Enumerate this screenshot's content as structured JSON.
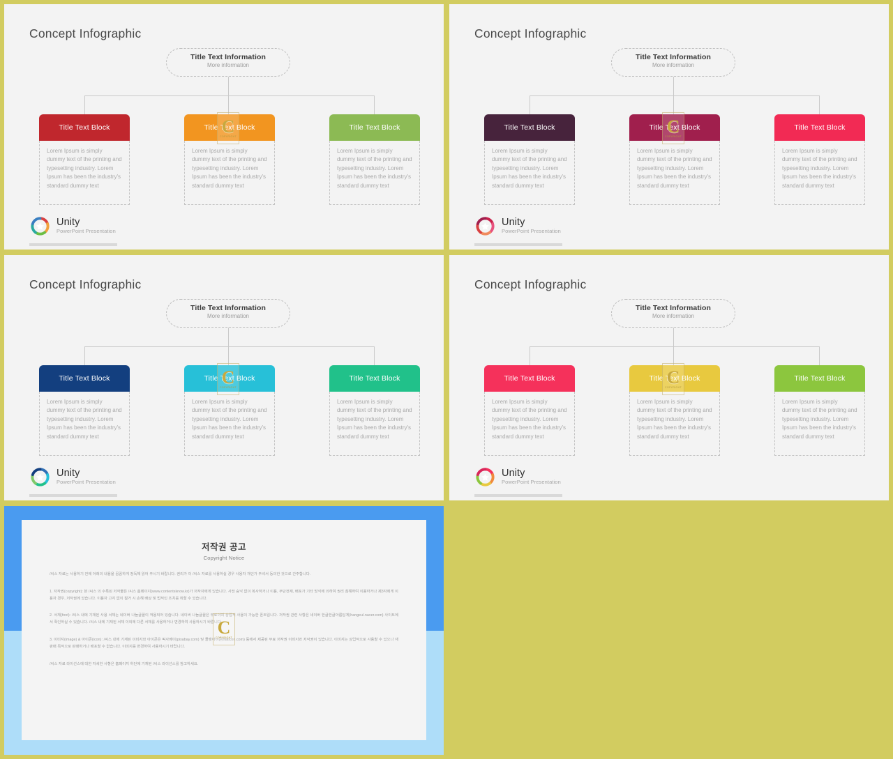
{
  "page": {
    "background_color": "#d2cc60",
    "divider_color": "#d2cc60"
  },
  "watermark": {
    "letter": "C",
    "caption": "COPYRIGHT"
  },
  "brand": {
    "name": "Unity",
    "tagline": "PowerPoint Presentation"
  },
  "slides": [
    {
      "id": "slide-1",
      "title": "Concept Infographic",
      "root": {
        "title": "Title  Text Information",
        "subtitle": "More information"
      },
      "cards": [
        {
          "title": "Title  Text Block",
          "color": "#c0272d",
          "body": "Lorem Ipsum is simply dummy text of the printing and typesetting industry. Lorem Ipsum has been the industry's standard dummy text"
        },
        {
          "title": "Title  Text Block",
          "color": "#f29520",
          "body": "Lorem Ipsum is simply dummy text of the printing and typesetting industry. Lorem Ipsum has been the industry's standard dummy text"
        },
        {
          "title": "Title  Text Block",
          "color": "#8cba54",
          "body": "Lorem Ipsum is simply dummy text of the printing and typesetting industry. Lorem Ipsum has been the industry's standard dummy text"
        }
      ]
    },
    {
      "id": "slide-2",
      "title": "Concept Infographic",
      "root": {
        "title": "Title  Text Information",
        "subtitle": "More information"
      },
      "cards": [
        {
          "title": "Title  Text Block",
          "color": "#47233c",
          "body": "Lorem Ipsum is simply dummy text of the printing and typesetting industry. Lorem Ipsum has been the industry's standard dummy text"
        },
        {
          "title": "Title  Text Block",
          "color": "#a01f4d",
          "body": "Lorem Ipsum is simply dummy text of the printing and typesetting industry. Lorem Ipsum has been the industry's standard dummy text"
        },
        {
          "title": "Title  Text Block",
          "color": "#f22a54",
          "body": "Lorem Ipsum is simply dummy text of the printing and typesetting industry. Lorem Ipsum has been the industry's standard dummy text"
        }
      ]
    },
    {
      "id": "slide-3",
      "title": "Concept Infographic",
      "root": {
        "title": "Title  Text Information",
        "subtitle": "More information"
      },
      "cards": [
        {
          "title": "Title  Text Block",
          "color": "#133f7f",
          "body": "Lorem Ipsum is simply dummy text of the printing and typesetting industry. Lorem Ipsum has been the industry's standard dummy text"
        },
        {
          "title": "Title  Text Block",
          "color": "#27c0d8",
          "body": "Lorem Ipsum is simply dummy text of the printing and typesetting industry. Lorem Ipsum has been the industry's standard dummy text"
        },
        {
          "title": "Title  Text Block",
          "color": "#21c18a",
          "body": "Lorem Ipsum is simply dummy text of the printing and typesetting industry. Lorem Ipsum has been the industry's standard dummy text"
        }
      ]
    },
    {
      "id": "slide-4",
      "title": "Concept Infographic",
      "root": {
        "title": "Title  Text Information",
        "subtitle": "More information"
      },
      "cards": [
        {
          "title": "Title  Text Block",
          "color": "#f5315b",
          "body": "Lorem Ipsum is simply dummy text of the printing and typesetting industry. Lorem Ipsum has been the industry's standard dummy text"
        },
        {
          "title": "Title  Text Block",
          "color": "#e8c93f",
          "body": "Lorem Ipsum is simply dummy text of the printing and typesetting industry. Lorem Ipsum has been the industry's standard dummy text"
        },
        {
          "title": "Title  Text Block",
          "color": "#8cc63e",
          "body": "Lorem Ipsum is simply dummy text of the printing and typesetting industry. Lorem Ipsum has been the industry's standard dummy text"
        }
      ]
    }
  ],
  "copyright_panel": {
    "border_color_top": "#4a9bf0",
    "border_color_bottom": "#aeddf9",
    "title": "저작권 공고",
    "subtitle": "Copyright Notice",
    "paragraphs": [
      "/씨스 자료는 사용하기 전에 아래의 내용을 꼼꼼하게 정독해 읽어 주시기 바랍니다. 권리가 이 /씨스 자료를 사용하실 경우 사용자 개인가 주셔서 동의한 것으로 간주합니다.",
      "1. 저작권(copyright): 본 /씨스 의 수록된 저작물은 /씨스 홈페이지(www.contentsknow.kr)가 저작자에게 있습니다. 사전 승낙 없이 복사하거나 이용, 무단전재, 배포가 기타 방식에 의하여 권리 침해하여 이용하거나 제3자에게 이용자 경우, 저작권에 있습니다. 이용자 고지 없이 철거 시 손해 배상 및 법적인 조치를 취할 수 있습니다.",
      "2. 서체(font): /씨스 내에 기재된 사용 서체는 네이버 나눔글꼴이 적용되어 있습니다. 네이버 나눔글꼴은 무료이며 상업적 사용이 가능한 폰트입니다. 저작권 관련 사항은 네이버 한글한글아름답게(hangeul.naver.com) 사이트에서 확인하실 수 있습니다. /씨스 내에 기재된 서체 이외에 다른 서체를 사용하거나 변경하여 사용하시기 바랍니다.",
      "3. 이미지(image) & 아이콘(icon): /씨스 내에 기재된 이미지와 아이콘은 픽사베이(pixabay.com) 및 플랫아이콘(flaticon.com) 등에서 제공된 무료 저작권 이미지와 저작권이 있습니다. 이미지는 상업적으로 사용할 수 있으나 재판매 목적으로 판매하거나 배포할 수 없습니다. 이미지를 변경하여 사용하시기 바랍니다.",
      "/씨스 자료 라이선스에 대한 자세한 사항은 홈페이지 하단에 기재된 /씨스 라이선스를 참고하세요."
    ]
  }
}
